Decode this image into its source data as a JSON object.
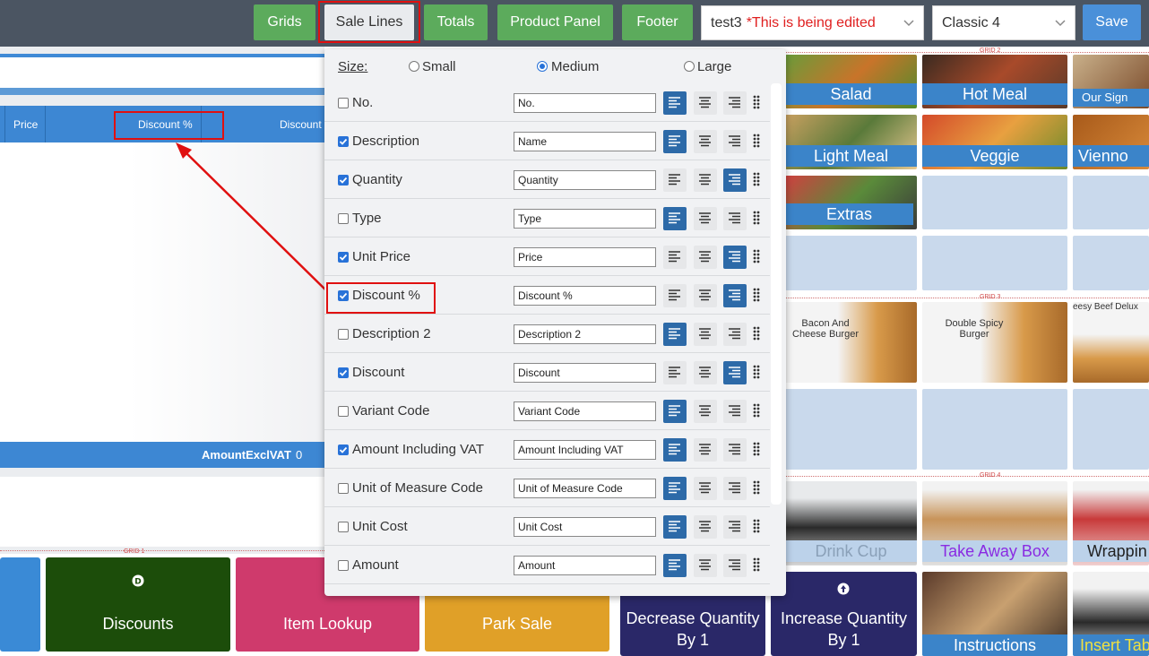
{
  "toolbar": {
    "buttons": [
      "Grids",
      "Sale Lines",
      "Totals",
      "Product Panel",
      "Footer"
    ],
    "layout_name": "test3",
    "layout_status": "*This is being edited",
    "theme": "Classic 4",
    "save_label": "Save"
  },
  "colors": {
    "topbar": "#4b5562",
    "green_button": "#5cab5c",
    "save_button": "#4a90d9",
    "highlight": "#e01010",
    "align_active": "#2d6aa8"
  },
  "sale_lines": {
    "columns": [
      "Price",
      "Discount %",
      "Discount"
    ],
    "footer_label": "AmountExclVAT",
    "footer_value": "0"
  },
  "panel": {
    "size_label": "Size:",
    "size_options": [
      "Small",
      "Medium",
      "Large"
    ],
    "size_selected": "Medium",
    "rows": [
      {
        "label": "No.",
        "checked": false,
        "value": "No.",
        "align": "left"
      },
      {
        "label": "Description",
        "checked": true,
        "value": "Name",
        "align": "left"
      },
      {
        "label": "Quantity",
        "checked": true,
        "value": "Quantity",
        "align": "right"
      },
      {
        "label": "Type",
        "checked": false,
        "value": "Type",
        "align": "left"
      },
      {
        "label": "Unit Price",
        "checked": true,
        "value": "Price",
        "align": "right"
      },
      {
        "label": "Discount %",
        "checked": true,
        "value": "Discount %",
        "align": "right"
      },
      {
        "label": "Description 2",
        "checked": false,
        "value": "Description 2",
        "align": "left"
      },
      {
        "label": "Discount",
        "checked": true,
        "value": "Discount",
        "align": "right"
      },
      {
        "label": "Variant Code",
        "checked": false,
        "value": "Variant Code",
        "align": "left"
      },
      {
        "label": "Amount Including VAT",
        "checked": true,
        "value": "Amount Including VAT",
        "align": "left"
      },
      {
        "label": "Unit of Measure Code",
        "checked": false,
        "value": "Unit of Measure Code",
        "align": "left"
      },
      {
        "label": "Unit Cost",
        "checked": false,
        "value": "Unit Cost",
        "align": "left"
      },
      {
        "label": "Amount",
        "checked": false,
        "value": "Amount",
        "align": "left"
      }
    ]
  },
  "grid_labels": [
    "GRID 1",
    "GRID 2",
    "GRID 3",
    "GRID 4"
  ],
  "tiles": {
    "salad": "Salad",
    "hot_meal": "Hot Meal",
    "our_sig": "Our Sign",
    "light_meal": "Light Meal",
    "veggie": "Veggie",
    "vienno": "Vienno",
    "extras": "Extras",
    "bacon_burger": "Bacon And Cheese Burger",
    "double_spicy": "Double Spicy Burger",
    "cheesy_beef": "eesy Beef Delux",
    "drink_cup": "Drink Cup",
    "take_away": "Take Away Box",
    "wrapping": "Wrappin",
    "instructions": "Instructions",
    "insert_tab": "Insert Tab"
  },
  "bottom": {
    "discounts": "Discounts",
    "item_lookup": "Item Lookup",
    "park_sale": "Park Sale",
    "decrease_qty": "Decrease Quantity By 1",
    "increase_qty": "Increase Quantity By 1"
  }
}
